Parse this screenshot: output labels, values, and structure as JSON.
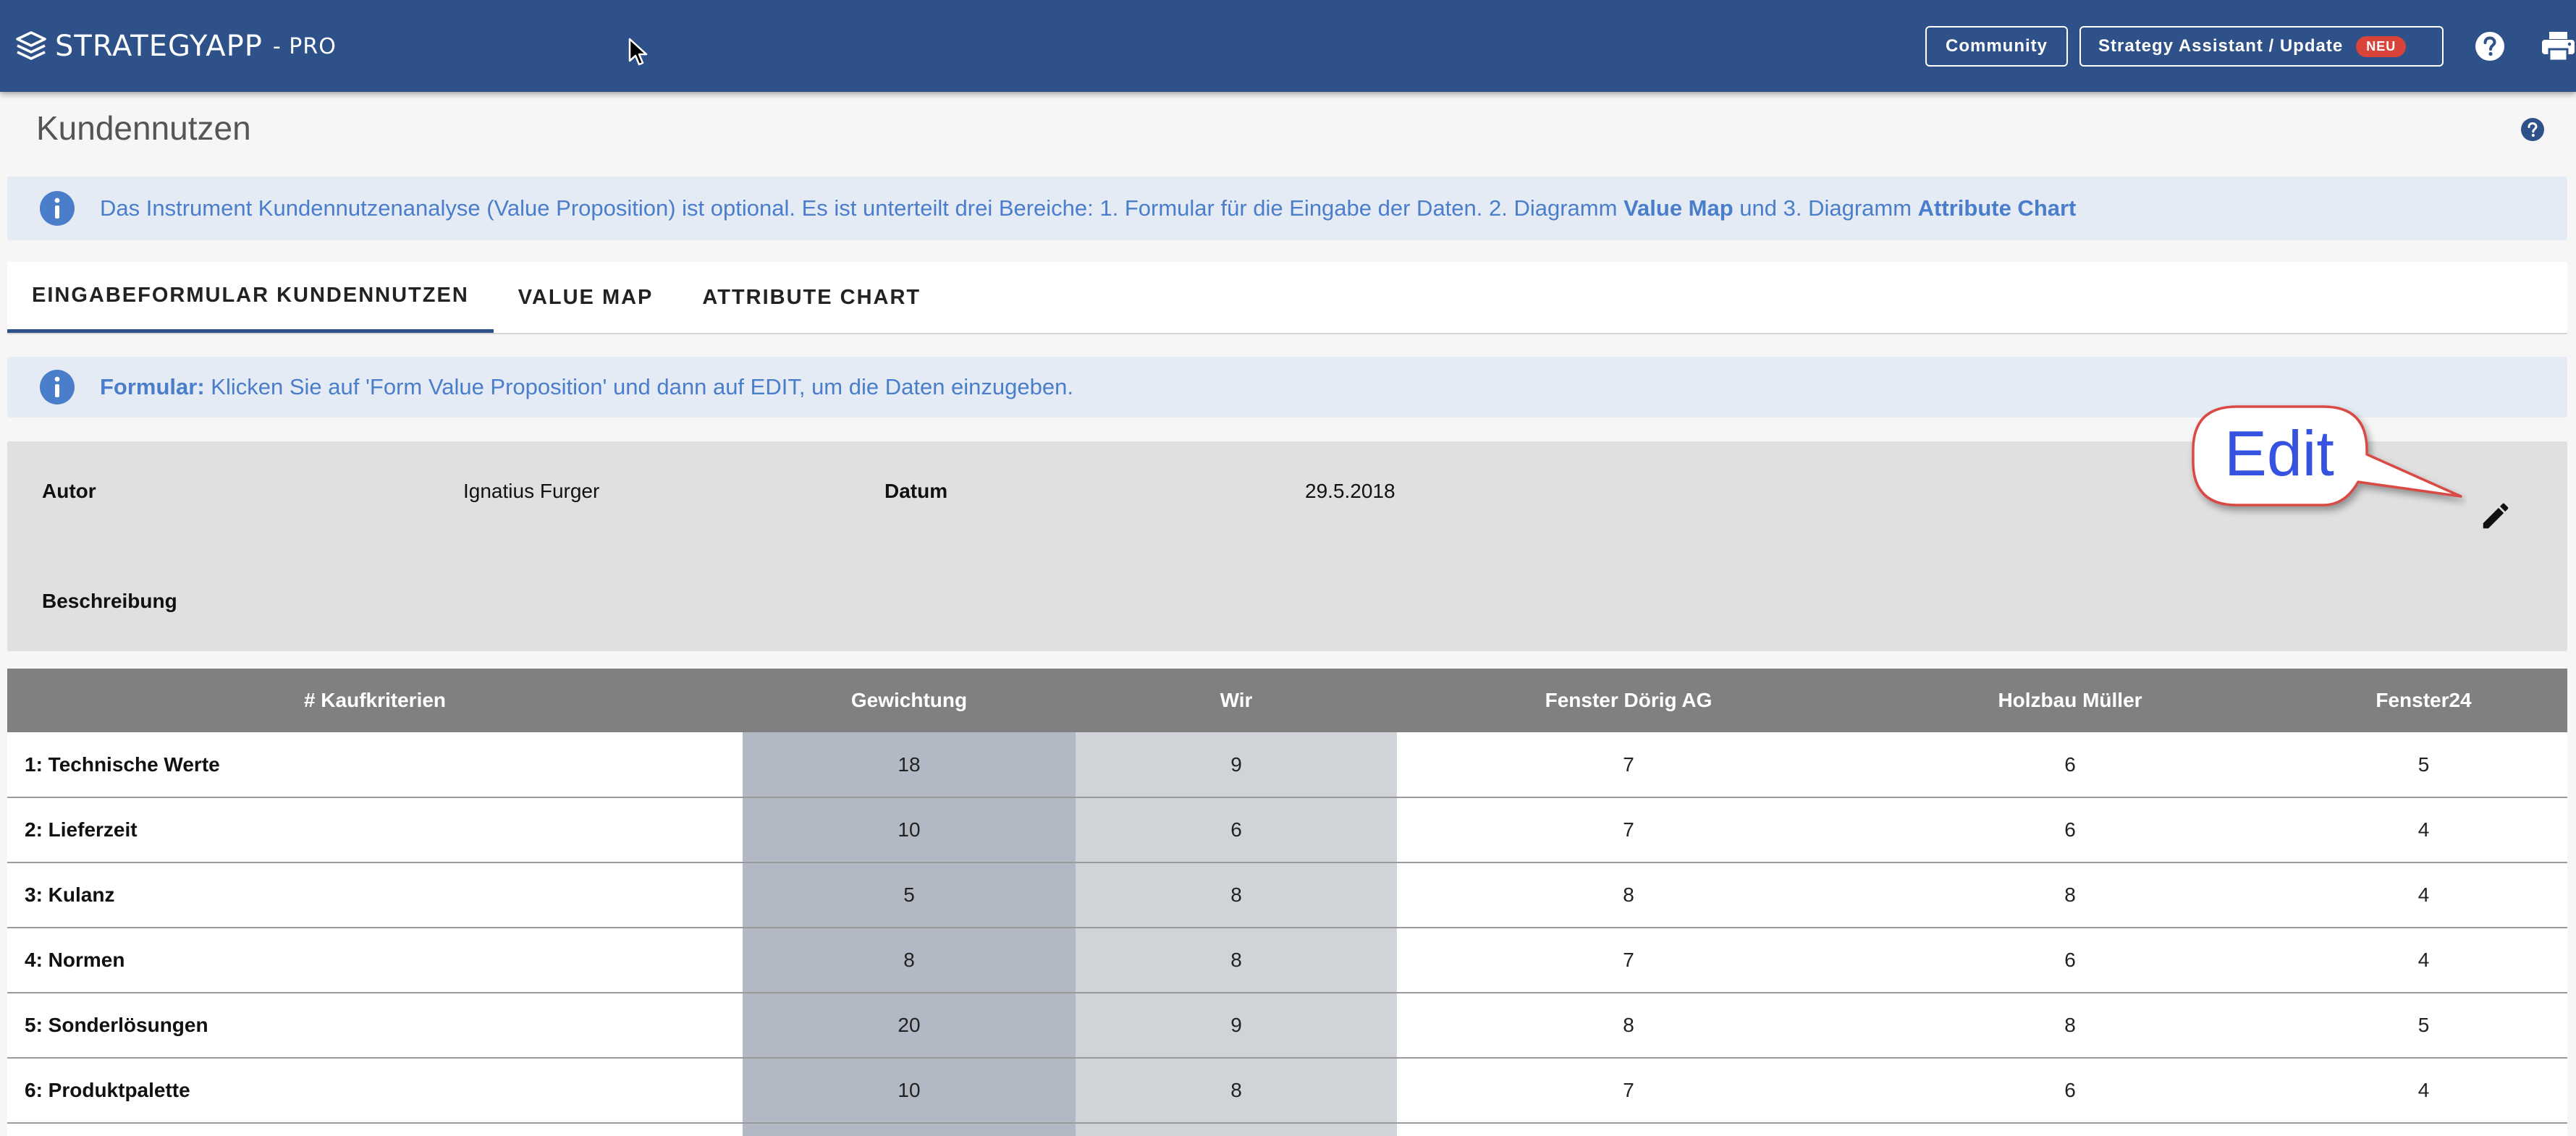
{
  "app": {
    "logo_text": "STRATEGYAPP",
    "logo_suffix": "- PRO",
    "community_label": "Community",
    "assistant_label": "Strategy Assistant / Update",
    "assistant_badge": "NEU",
    "brand_color": "#2f5189",
    "icons": [
      "stack-logo-icon",
      "mouse-cursor-icon",
      "help-icon",
      "print-icon"
    ]
  },
  "page": {
    "title": "Kundennutzen"
  },
  "intro_banner": {
    "text_before": "Das Instrument Kundennutzenanalyse (Value Proposition) ist optional. Es ist unterteilt drei Bereiche: 1. Formular für die Eingabe der Daten. 2. Diagramm ",
    "bold_1": "Value Map",
    "text_middle": " und 3. Diagramm ",
    "bold_2": "Attribute Chart"
  },
  "tabs": [
    {
      "label": "EINGABEFORMULAR KUNDENNUTZEN",
      "active": true
    },
    {
      "label": "VALUE MAP",
      "active": false
    },
    {
      "label": "ATTRIBUTE CHART",
      "active": false
    }
  ],
  "form_banner": {
    "bold": "Formular:",
    "text": " Klicken Sie auf 'Form Value Proposition' und dann auf EDIT, um die Daten einzugeben."
  },
  "meta": {
    "author_label": "Autor",
    "author_value": "Ignatius Furger",
    "date_label": "Datum",
    "date_value": "29.5.2018",
    "description_label": "Beschreibung"
  },
  "callout": {
    "text": "Edit"
  },
  "table": {
    "headers": [
      "# Kaufkriterien",
      "Gewichtung",
      "Wir",
      "Fenster Dörig AG",
      "Holzbau Müller",
      "Fenster24"
    ],
    "rows": [
      [
        "1: Technische Werte",
        "18",
        "9",
        "7",
        "6",
        "5"
      ],
      [
        "2: Lieferzeit",
        "10",
        "6",
        "7",
        "6",
        "4"
      ],
      [
        "3: Kulanz",
        "5",
        "8",
        "8",
        "8",
        "4"
      ],
      [
        "4: Normen",
        "8",
        "8",
        "7",
        "6",
        "4"
      ],
      [
        "5: Sonderlösungen",
        "20",
        "9",
        "8",
        "8",
        "5"
      ],
      [
        "6: Produktpalette",
        "10",
        "8",
        "7",
        "6",
        "4"
      ],
      [
        "",
        "",
        "",
        "",
        "",
        ""
      ]
    ]
  }
}
